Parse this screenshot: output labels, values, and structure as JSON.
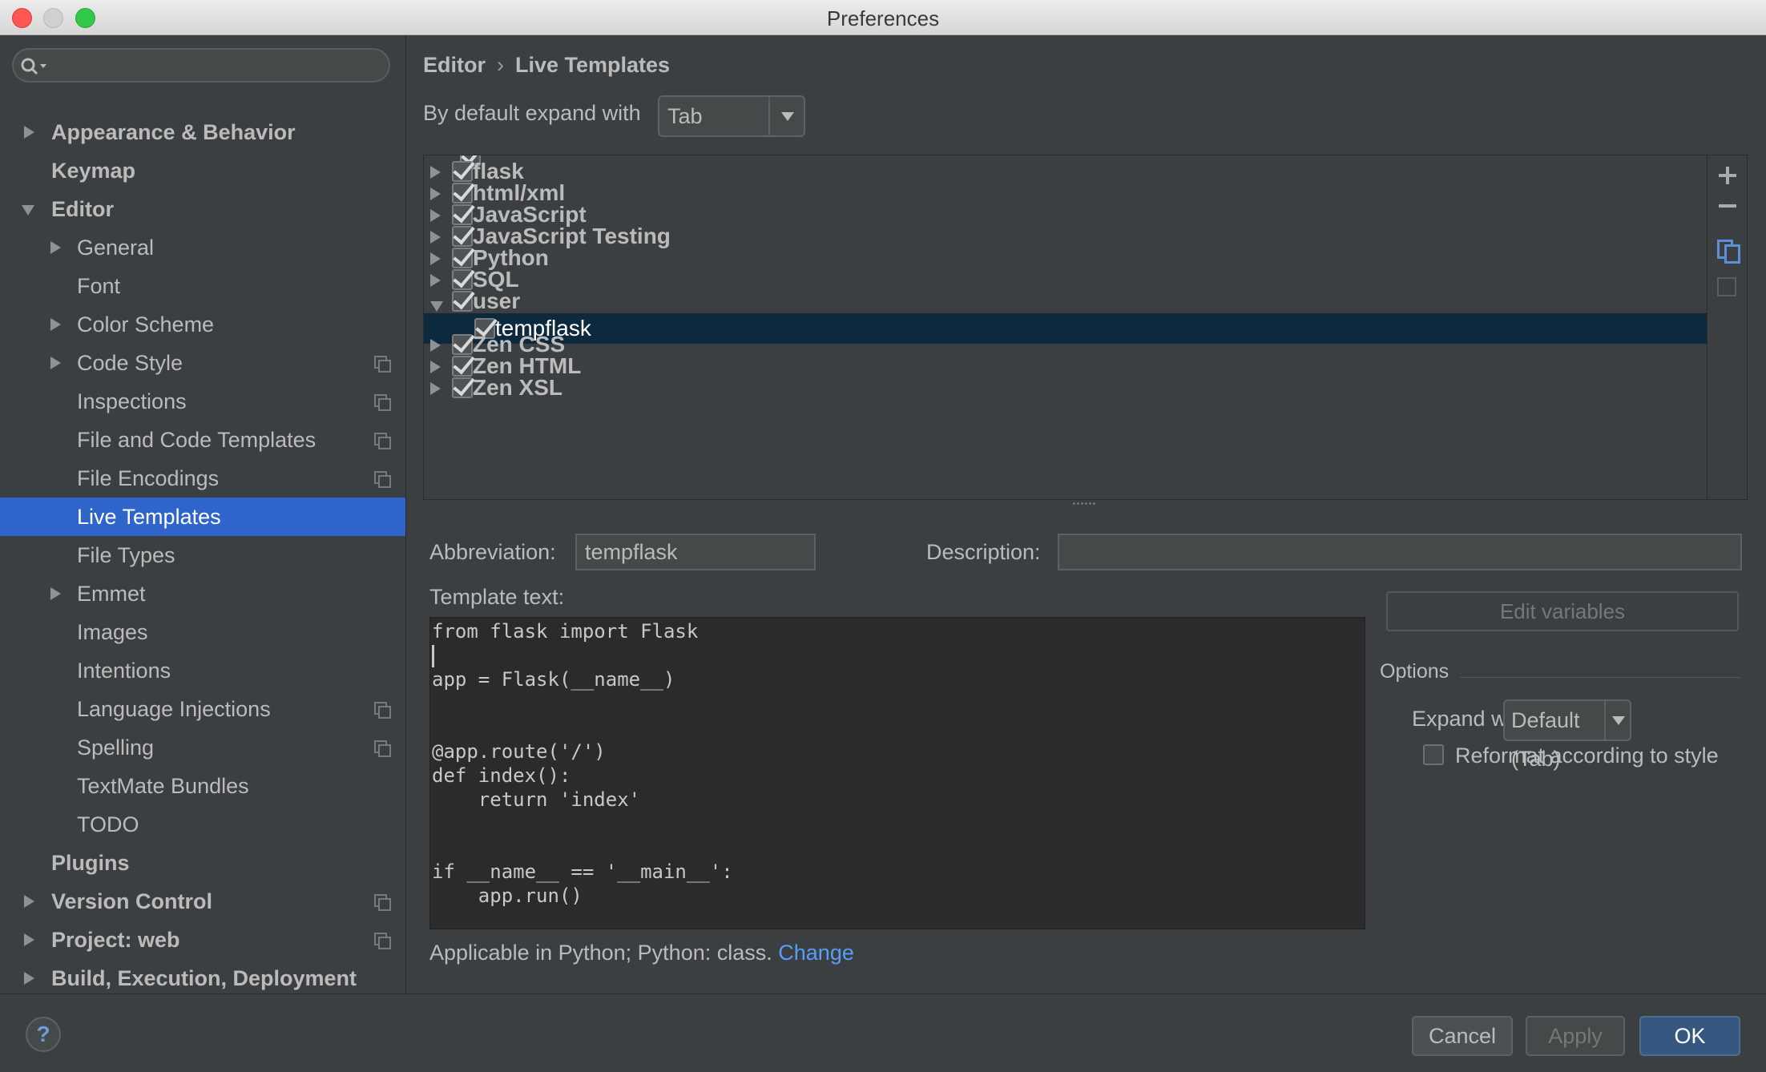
{
  "window": {
    "title": "Preferences"
  },
  "search": {
    "placeholder": ""
  },
  "sidebar": {
    "items": [
      {
        "label": "Appearance & Behavior"
      },
      {
        "label": "Keymap"
      },
      {
        "label": "Editor"
      },
      {
        "label": "General"
      },
      {
        "label": "Font"
      },
      {
        "label": "Color Scheme"
      },
      {
        "label": "Code Style"
      },
      {
        "label": "Inspections"
      },
      {
        "label": "File and Code Templates"
      },
      {
        "label": "File Encodings"
      },
      {
        "label": "Live Templates"
      },
      {
        "label": "File Types"
      },
      {
        "label": "Emmet"
      },
      {
        "label": "Images"
      },
      {
        "label": "Intentions"
      },
      {
        "label": "Language Injections"
      },
      {
        "label": "Spelling"
      },
      {
        "label": "TextMate Bundles"
      },
      {
        "label": "TODO"
      },
      {
        "label": "Plugins"
      },
      {
        "label": "Version Control"
      },
      {
        "label": "Project: web"
      },
      {
        "label": "Build, Execution, Deployment"
      }
    ]
  },
  "breadcrumb": {
    "parent": "Editor",
    "separator": "›",
    "current": "Live Templates"
  },
  "expand": {
    "label": "By default expand with",
    "value": "Tab"
  },
  "tree": {
    "groups": [
      {
        "name": "flask"
      },
      {
        "name": "html/xml"
      },
      {
        "name": "JavaScript"
      },
      {
        "name": "JavaScript Testing"
      },
      {
        "name": "Python"
      },
      {
        "name": "SQL"
      },
      {
        "name": "user"
      },
      {
        "name": "tempflask"
      },
      {
        "name": "Zen CSS"
      },
      {
        "name": "Zen HTML"
      },
      {
        "name": "Zen XSL"
      }
    ]
  },
  "detail": {
    "abbreviation_label": "Abbreviation:",
    "abbreviation_value": "tempflask",
    "description_label": "Description:",
    "description_value": "",
    "template_text_label": "Template text:",
    "template_lines": [
      "from flask import Flask",
      "",
      "app = Flask(__name__)",
      "",
      "",
      "@app.route('/')",
      "def index():",
      "    return 'index'",
      "",
      "",
      "if __name__ == '__main__':",
      "    app.run()"
    ],
    "edit_variables_label": "Edit variables",
    "options_label": "Options",
    "expand_with_label": "Expand with",
    "expand_with_value": "Default (Tab)",
    "reformat_label": "Reformat according to style",
    "applicable_text": "Applicable in Python; Python: class.",
    "change_link": "Change"
  },
  "footer": {
    "help": "?",
    "cancel": "Cancel",
    "apply": "Apply",
    "ok": "OK"
  },
  "colors": {
    "selection": "#2f65ca",
    "tree_selection": "#0d293e",
    "link": "#589df6",
    "primary_button": "#365880"
  }
}
